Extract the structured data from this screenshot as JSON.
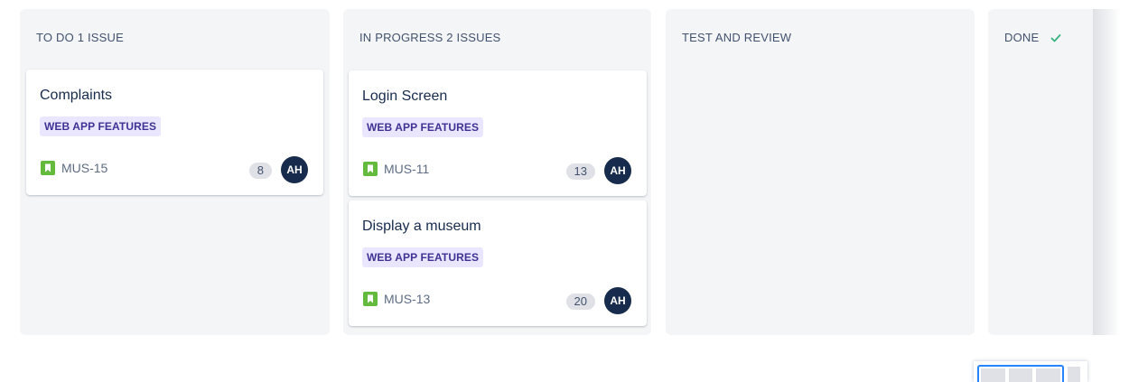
{
  "board": {
    "columns": [
      {
        "title": "TO DO 1 ISSUE",
        "cards": [
          {
            "title": "Complaints",
            "epic": "WEB APP FEATURES",
            "key": "MUS-15",
            "points": "8",
            "avatar": "AH"
          }
        ]
      },
      {
        "title": "IN PROGRESS 2 ISSUES",
        "cards": [
          {
            "title": "Login Screen",
            "epic": "WEB APP FEATURES",
            "key": "MUS-11",
            "points": "13",
            "avatar": "AH"
          },
          {
            "title": "Display a museum",
            "epic": "WEB APP FEATURES",
            "key": "MUS-13",
            "points": "20",
            "avatar": "AH"
          }
        ]
      },
      {
        "title": "TEST AND REVIEW",
        "cards": []
      },
      {
        "title": "DONE",
        "cards": []
      }
    ]
  },
  "colors": {
    "column_bg": "#f4f5f7",
    "epic_bg": "#eae6ff",
    "epic_text": "#403294",
    "story_icon": "#63ba3c",
    "avatar_bg": "#172b4d",
    "done_check": "#36b37e"
  },
  "icons": {
    "story": "story-bookmark-icon",
    "done": "checkmark-icon"
  }
}
